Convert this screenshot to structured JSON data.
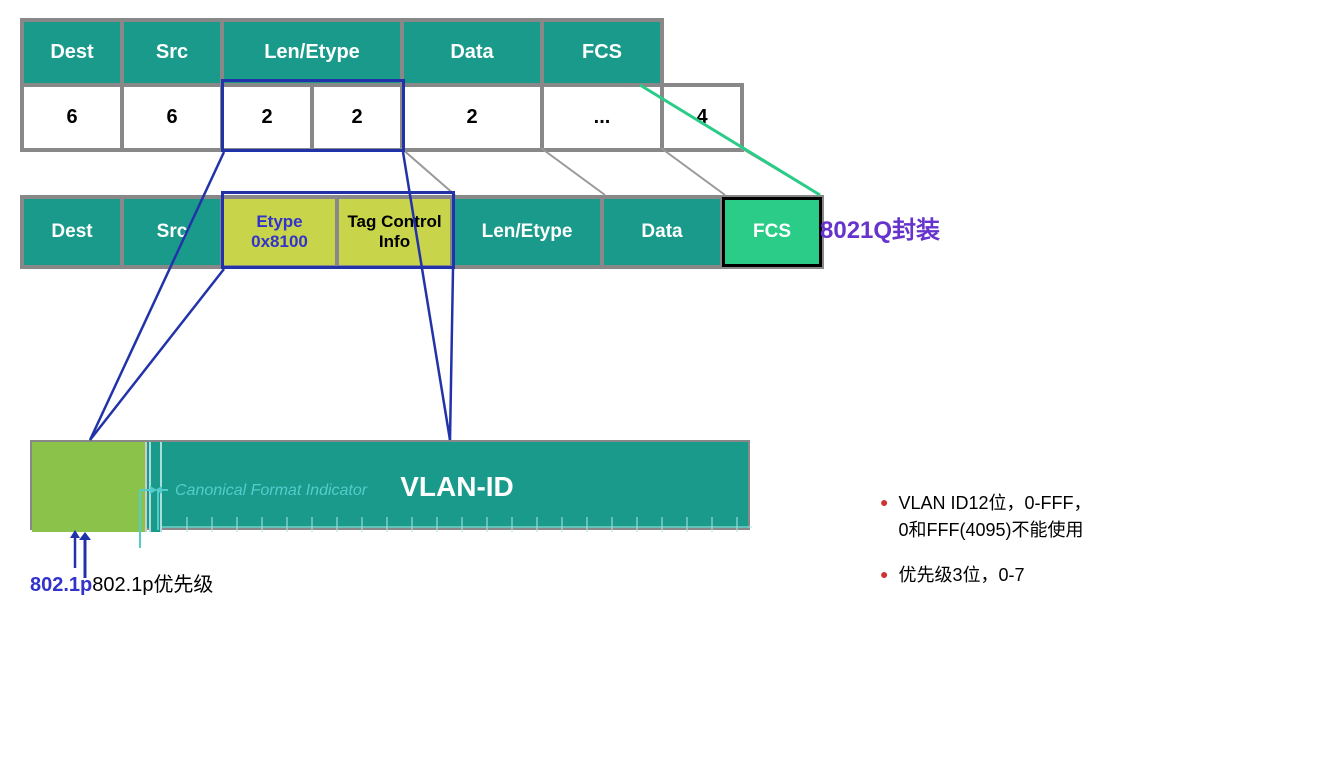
{
  "top_frame": {
    "cells": [
      {
        "id": "dest",
        "label": "Dest"
      },
      {
        "id": "src",
        "label": "Src"
      },
      {
        "id": "len",
        "label": "Len/Etype"
      },
      {
        "id": "data",
        "label": "Data"
      },
      {
        "id": "fcs",
        "label": "FCS"
      }
    ]
  },
  "numbers_row": {
    "cells": [
      "6",
      "6",
      "2",
      "2",
      "2",
      "...",
      "4"
    ]
  },
  "bottom_frame": {
    "cells": [
      {
        "id": "dest",
        "label": "Dest"
      },
      {
        "id": "src",
        "label": "Src"
      },
      {
        "id": "etype",
        "label": "Etype\n0x8100"
      },
      {
        "id": "tci",
        "label": "Tag Control\nInfo"
      },
      {
        "id": "len",
        "label": "Len/Etype"
      },
      {
        "id": "data",
        "label": "Data"
      },
      {
        "id": "fcs",
        "label": "FCS"
      }
    ]
  },
  "label_8021q": "8021Q封装",
  "vlan": {
    "vlan_id_label": "VLAN-ID"
  },
  "cfi_label": "Canonical Format Indicator",
  "label_8021p": "802.1p优先级",
  "info_list": [
    "VLAN ID12位，0-FFF，\n0和FFF(4095)不能使用",
    "优先级3位，0-7"
  ]
}
